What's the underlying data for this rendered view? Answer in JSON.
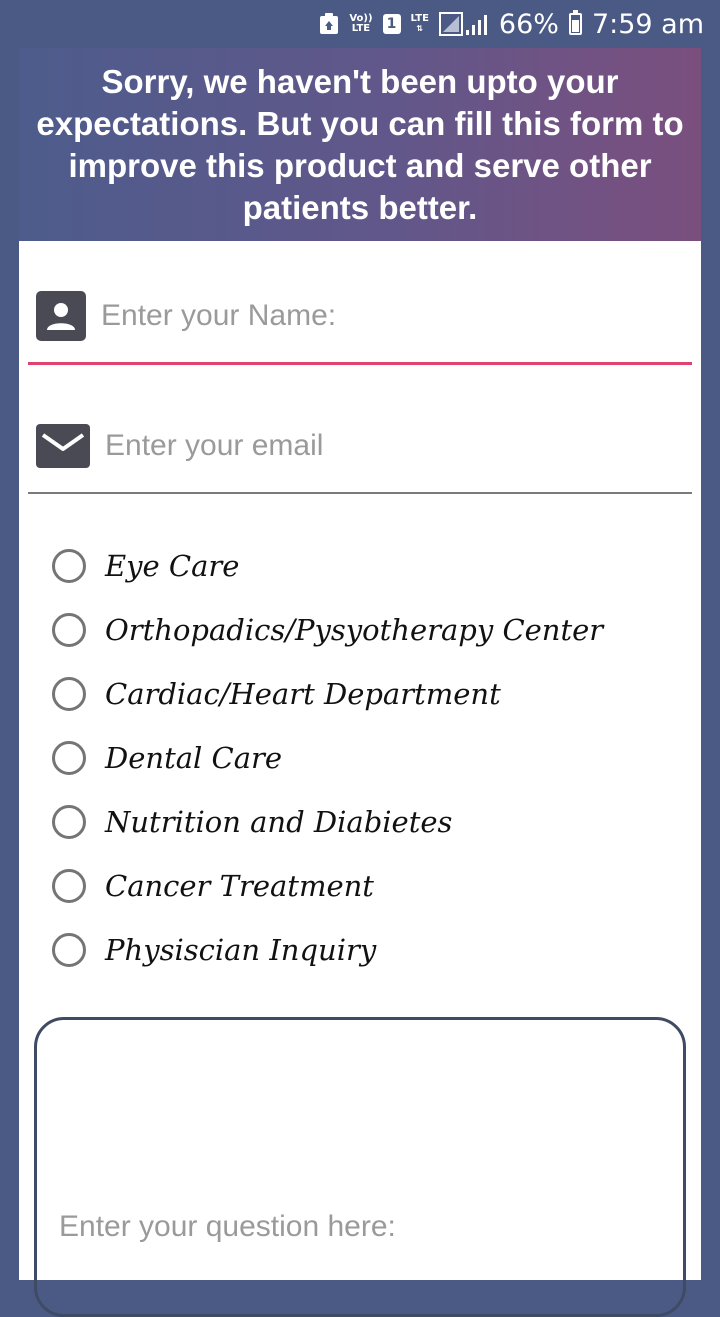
{
  "status_bar": {
    "volte_top": "Vo))",
    "volte_bottom": "LTE",
    "sim_slot": "1",
    "network_type": "LTE",
    "battery_percent": "66%",
    "time": "7:59 am"
  },
  "banner": {
    "message": "Sorry, we haven't been upto your expectations. But you can fill this form to improve this product and serve other patients better."
  },
  "form": {
    "name_placeholder": "Enter your Name:",
    "email_placeholder": "Enter your email",
    "departments": [
      {
        "label": "Eye Care",
        "selected": false
      },
      {
        "label": "Orthopadics/Pysyotherapy Center",
        "selected": false
      },
      {
        "label": "Cardiac/Heart Department",
        "selected": false
      },
      {
        "label": "Dental Care",
        "selected": false
      },
      {
        "label": "Nutrition and Diabietes",
        "selected": false
      },
      {
        "label": "Cancer Treatment",
        "selected": false
      },
      {
        "label": "Physiscian Inquiry",
        "selected": false
      }
    ],
    "question_placeholder": "Enter your question here:"
  },
  "colors": {
    "background": "#4b5a85",
    "focus_underline": "#e0436f",
    "icon_tile": "#4a4a55"
  },
  "icons": [
    "recycle-icon",
    "volte-icon",
    "sim-icon",
    "lte-icon",
    "signal-icon",
    "battery-icon",
    "person-icon",
    "mail-icon"
  ]
}
